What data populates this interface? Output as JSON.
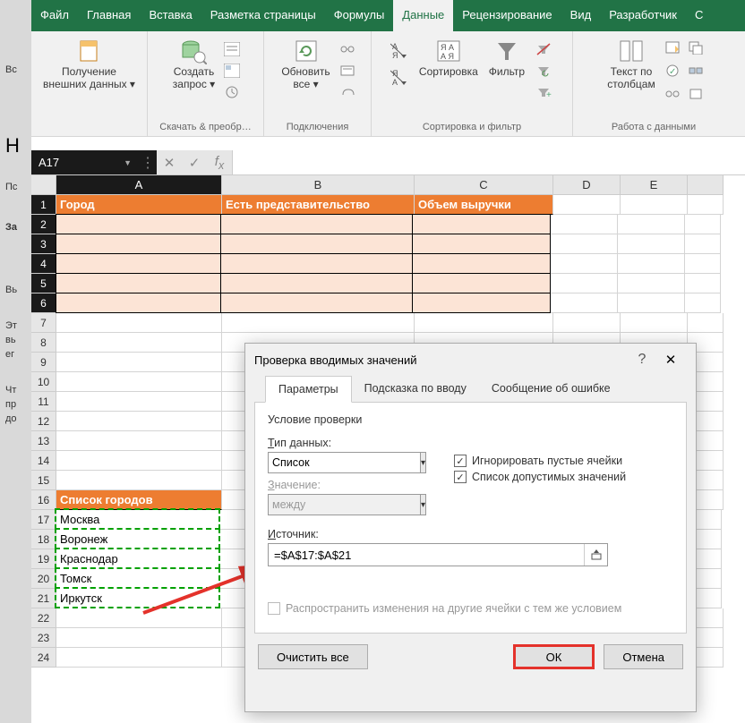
{
  "left_text": {
    "a": "Вс",
    "b": "Н",
    "c": "Пс",
    "d": "За",
    "e": "Вь",
    "f": "Эт",
    "g": "вь",
    "h": "ег",
    "i": "Чт",
    "j": "пр",
    "k": "до"
  },
  "tabs": {
    "file": "Файл",
    "home": "Главная",
    "insert": "Вставка",
    "layout": "Разметка страницы",
    "formulas": "Формулы",
    "data": "Данные",
    "review": "Рецензирование",
    "view": "Вид",
    "dev": "Разработчик",
    "last": "С"
  },
  "ribbon": {
    "g1": {
      "label": "Получение\nвнешних данных ▾",
      "group": ""
    },
    "g2": {
      "label": "Создать\nзапрос ▾",
      "group": "Скачать & преобр…"
    },
    "g3": {
      "label": "Обновить\nвсе ▾",
      "group": "Подключения"
    },
    "g4": {
      "sort": "Сортировка",
      "filter": "Фильтр",
      "group": "Сортировка и фильтр"
    },
    "g5": {
      "label": "Текст по\nстолбцам",
      "group": "Работа с данными"
    }
  },
  "namebox": "A17",
  "colheads": {
    "A": "A",
    "B": "B",
    "C": "C",
    "D": "D",
    "E": "E"
  },
  "sheet": {
    "r1": {
      "A": "Город",
      "B": "Есть представительство",
      "C": "Объем выручки"
    },
    "r16": {
      "A": "Список городов"
    },
    "r17": {
      "A": "Москва"
    },
    "r18": {
      "A": "Воронеж"
    },
    "r19": {
      "A": "Краснодар"
    },
    "r20": {
      "A": "Томск"
    },
    "r21": {
      "A": "Иркутск"
    }
  },
  "dialog": {
    "title": "Проверка вводимых значений",
    "tab1": "Параметры",
    "tab2": "Подсказка по вводу",
    "tab3": "Сообщение об ошибке",
    "section": "Условие проверки",
    "lbl_type": "Тип данных:",
    "val_type": "Список",
    "lbl_value": "Значение:",
    "val_value": "между",
    "chk1": "Игнорировать пустые ячейки",
    "chk2": "Список допустимых значений",
    "lbl_src": "Источник:",
    "val_src": "=$A$17:$A$21",
    "propagate": "Распространить изменения на другие ячейки с тем же условием",
    "clear": "Очистить все",
    "ok": "ОК",
    "cancel": "Отмена"
  }
}
